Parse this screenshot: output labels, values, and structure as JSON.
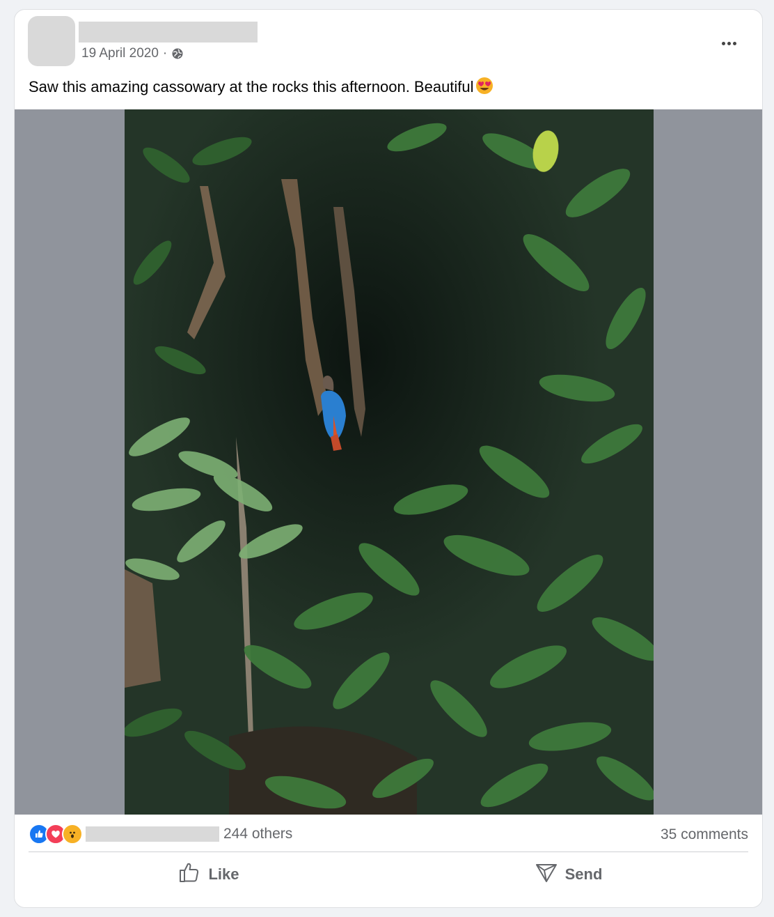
{
  "post": {
    "date": "19 April 2020",
    "separator": "·",
    "audience_icon": "globe-icon",
    "more_icon": "more-options-icon",
    "text": "Saw this amazing cassowary at the rocks this afternoon. Beautiful",
    "emoji": "heart-eyes-emoji"
  },
  "photo": {
    "subject": "cassowary-in-rainforest"
  },
  "stats": {
    "reaction_icons": [
      "like-reaction-icon",
      "love-reaction-icon",
      "wow-reaction-icon"
    ],
    "others_text": "244 others",
    "comments_text": "35 comments"
  },
  "actions": {
    "like_label": "Like",
    "send_label": "Send"
  },
  "colors": {
    "like_blue": "#1877f2",
    "love_red": "#f33e58",
    "wow_yellow": "#f7b125",
    "secondary_text": "#65676b",
    "photo_letterbox": "#90949c"
  }
}
